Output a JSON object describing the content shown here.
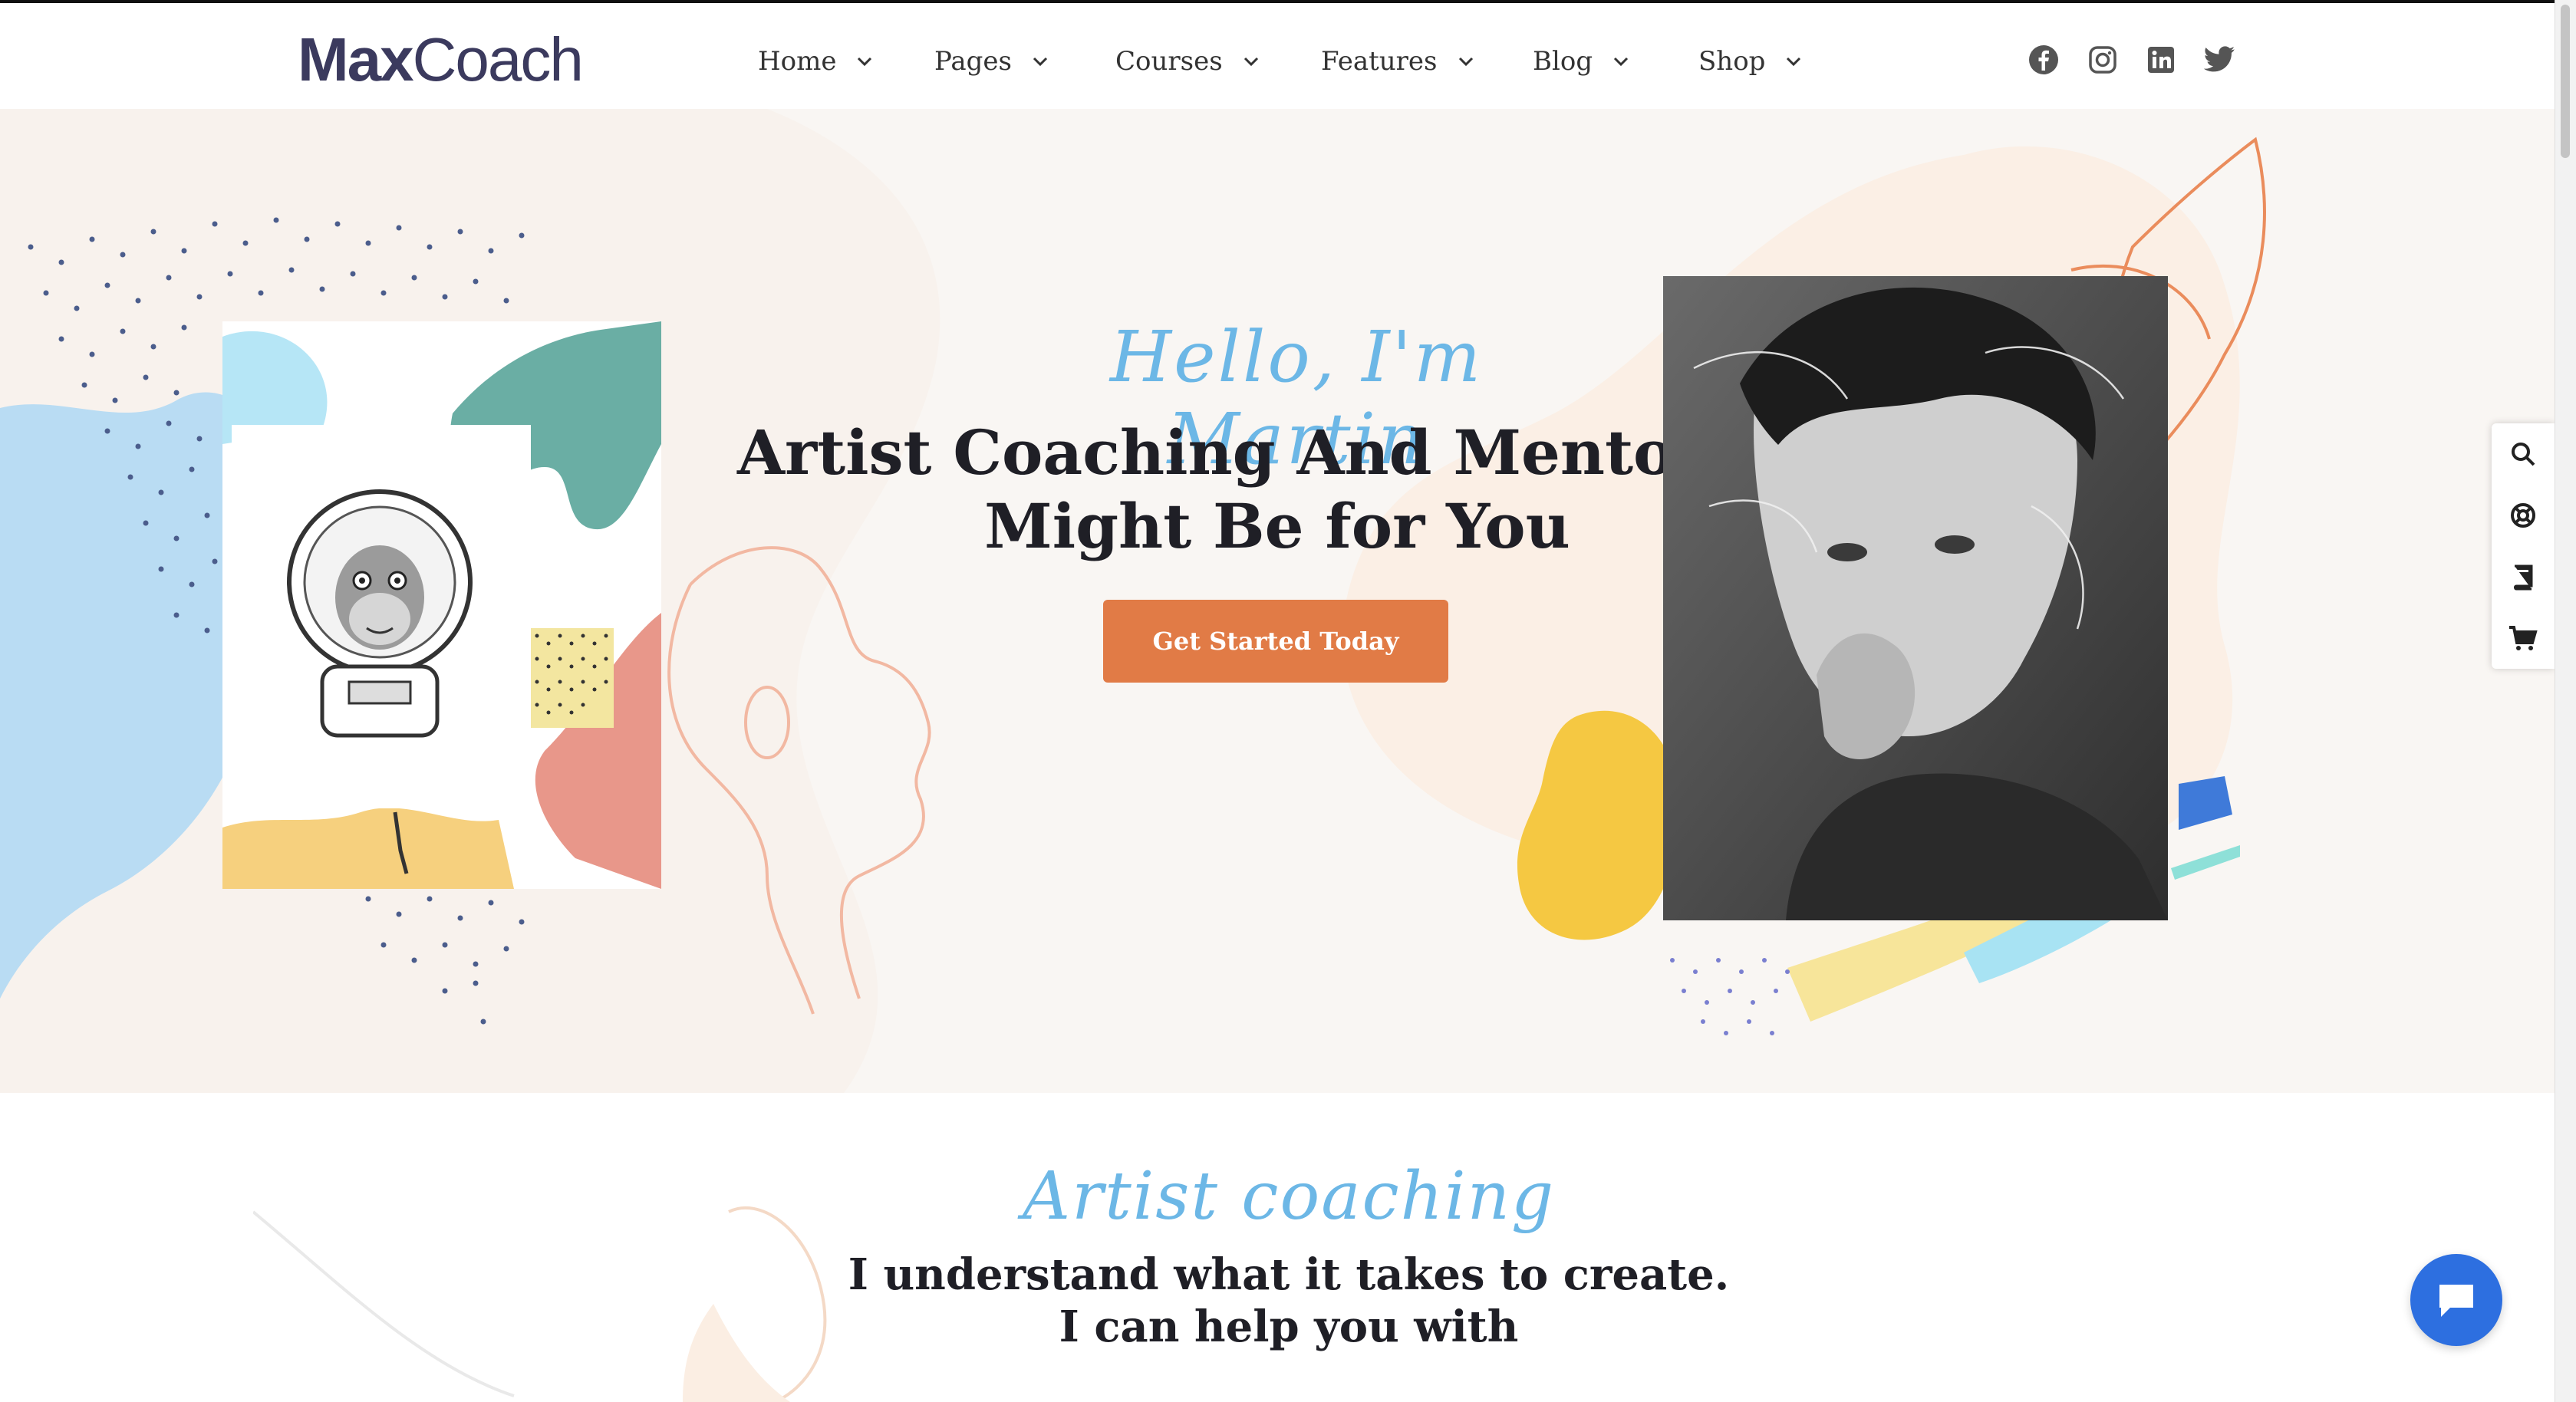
{
  "logo": {
    "bold": "Max",
    "light": "Coach"
  },
  "nav": [
    {
      "label": "Home"
    },
    {
      "label": "Pages"
    },
    {
      "label": "Courses"
    },
    {
      "label": "Features"
    },
    {
      "label": "Blog"
    },
    {
      "label": "Shop"
    }
  ],
  "social": [
    "facebook-icon",
    "instagram-icon",
    "linkedin-icon",
    "twitter-icon"
  ],
  "hero": {
    "script": "Hello, I'm Martin",
    "title_line1": "Artist Coaching And Mentoring",
    "title_line2": "Might Be for You",
    "cta": "Get Started Today"
  },
  "section2": {
    "script": "Artist coaching",
    "title_line1": "I understand what it takes to create.",
    "title_line2": "I can help you with"
  },
  "tools": [
    "search-icon",
    "lifebuoy-icon",
    "book-icon",
    "cart-icon"
  ],
  "colors": {
    "accent": "#e17b46",
    "script": "#6cb7e6",
    "brand": "#3b3a5e",
    "chat": "#2d6fe0"
  }
}
